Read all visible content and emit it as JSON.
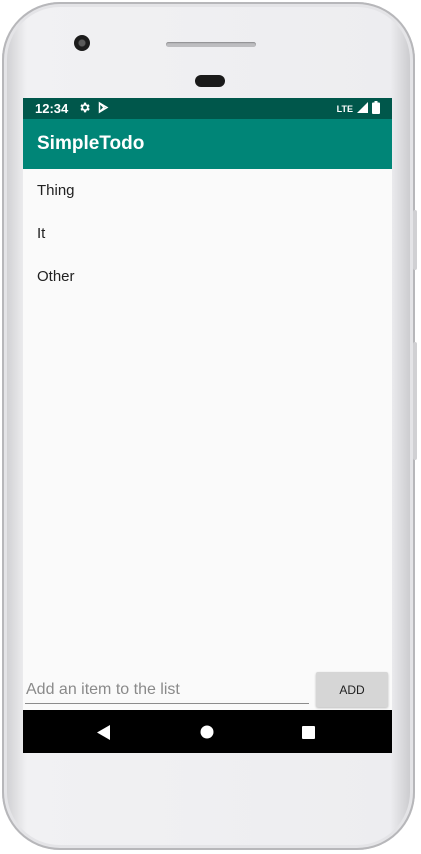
{
  "status_bar": {
    "time": "12:34",
    "network": "LTE",
    "icons": [
      "gear-icon",
      "play-store-icon",
      "signal-icon",
      "battery-icon"
    ],
    "background": "#00574b"
  },
  "app_bar": {
    "title": "SimpleTodo",
    "background": "#008577"
  },
  "todo_list": {
    "items": [
      {
        "label": "Thing"
      },
      {
        "label": "It"
      },
      {
        "label": "Other"
      }
    ]
  },
  "add_form": {
    "input_value": "",
    "input_placeholder": "Add an item to the list",
    "button_label": "ADD"
  },
  "nav_bar": {
    "icons": [
      "back-icon",
      "home-icon",
      "recents-icon"
    ]
  }
}
